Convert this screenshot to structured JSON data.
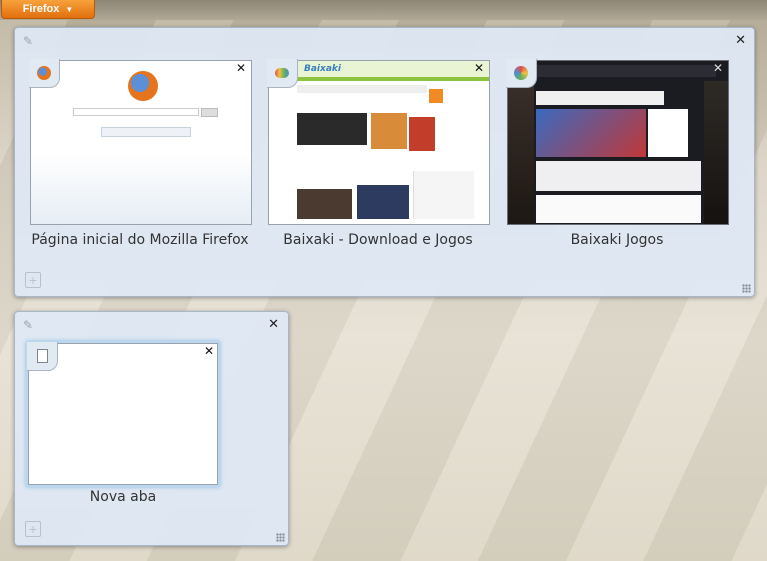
{
  "toolbar": {
    "app_button_label": "Firefox"
  },
  "groups": [
    {
      "tabs": [
        {
          "title": "Página inicial do Mozilla Firefox",
          "favicon": "firefox-icon"
        },
        {
          "title": "Baixaki - Download e Jogos",
          "favicon": "baixaki-icon",
          "logo_text": "Baixaki"
        },
        {
          "title": "Baixaki Jogos",
          "favicon": "baixaki-jogos-icon"
        }
      ]
    },
    {
      "tabs": [
        {
          "title": "Nova aba",
          "favicon": "page-icon"
        }
      ]
    }
  ],
  "colors": {
    "accent": "#e87b1a",
    "group_bg": "#dee8f4",
    "group_border": "#a7b6c8"
  }
}
